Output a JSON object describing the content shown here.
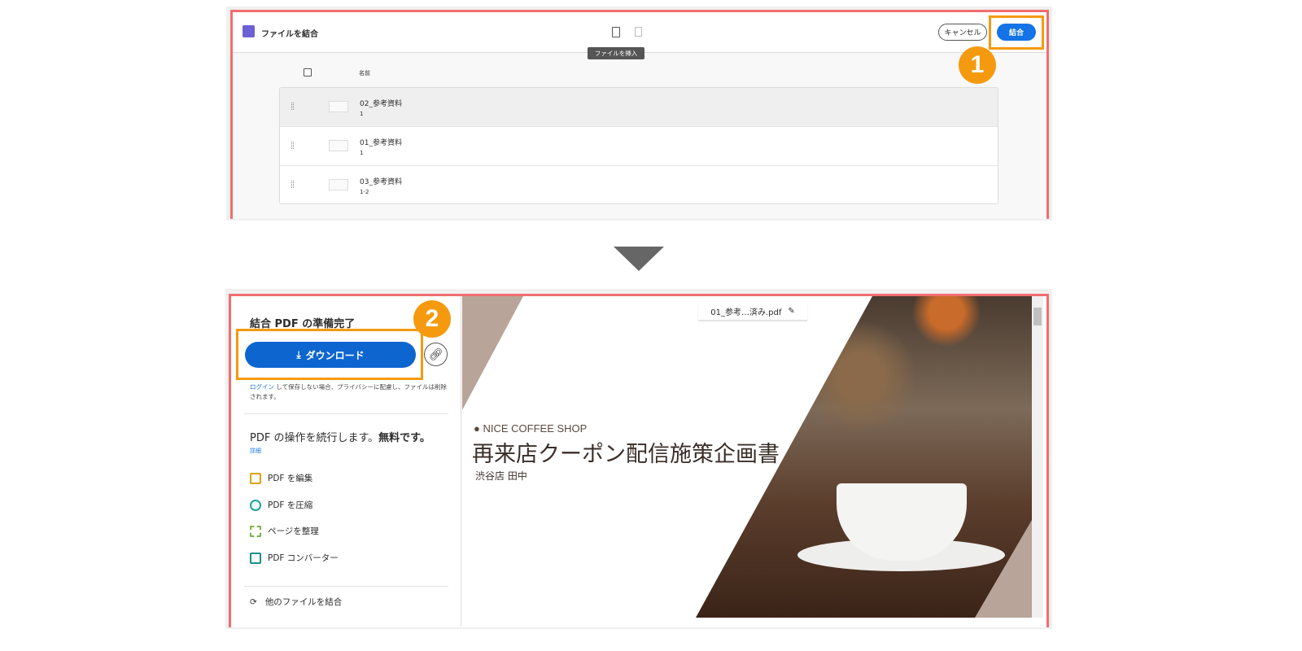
{
  "step1": {
    "title": "ファイルを結合",
    "tooltip": "ファイルを挿入",
    "cancel": "キャンセル",
    "combine": "結合",
    "badge": "1",
    "column_name": "名前",
    "files": [
      {
        "name": "02_参考資料",
        "pages": "1"
      },
      {
        "name": "01_参考資料",
        "pages": "1"
      },
      {
        "name": "03_参考資料",
        "pages": "1-2"
      }
    ]
  },
  "step2": {
    "ready": "結合 PDF の準備完了",
    "download": "ダウンロード",
    "badge": "2",
    "note_link": "ログイン",
    "note": " して保存しない場合、プライバシーに配慮し、ファイルは削除されます。",
    "continue": "PDF の操作を続行します。",
    "free": "無料です。",
    "more": "詳細",
    "tools": [
      {
        "label": "PDF を編集",
        "color": "#d9a400"
      },
      {
        "label": "PDF を圧縮",
        "color": "#1aa39a"
      },
      {
        "label": "ページを整理",
        "color": "#7cb342"
      },
      {
        "label": "PDF コンバーター",
        "color": "#1a8f8a"
      }
    ],
    "other": "他のファイルを結合",
    "filename": "01_参考…済み.pdf",
    "slide": {
      "brand": "NICE COFFEE SHOP",
      "title": "再来店クーポン配信施策企画書",
      "sub": "渋谷店 田中"
    }
  }
}
